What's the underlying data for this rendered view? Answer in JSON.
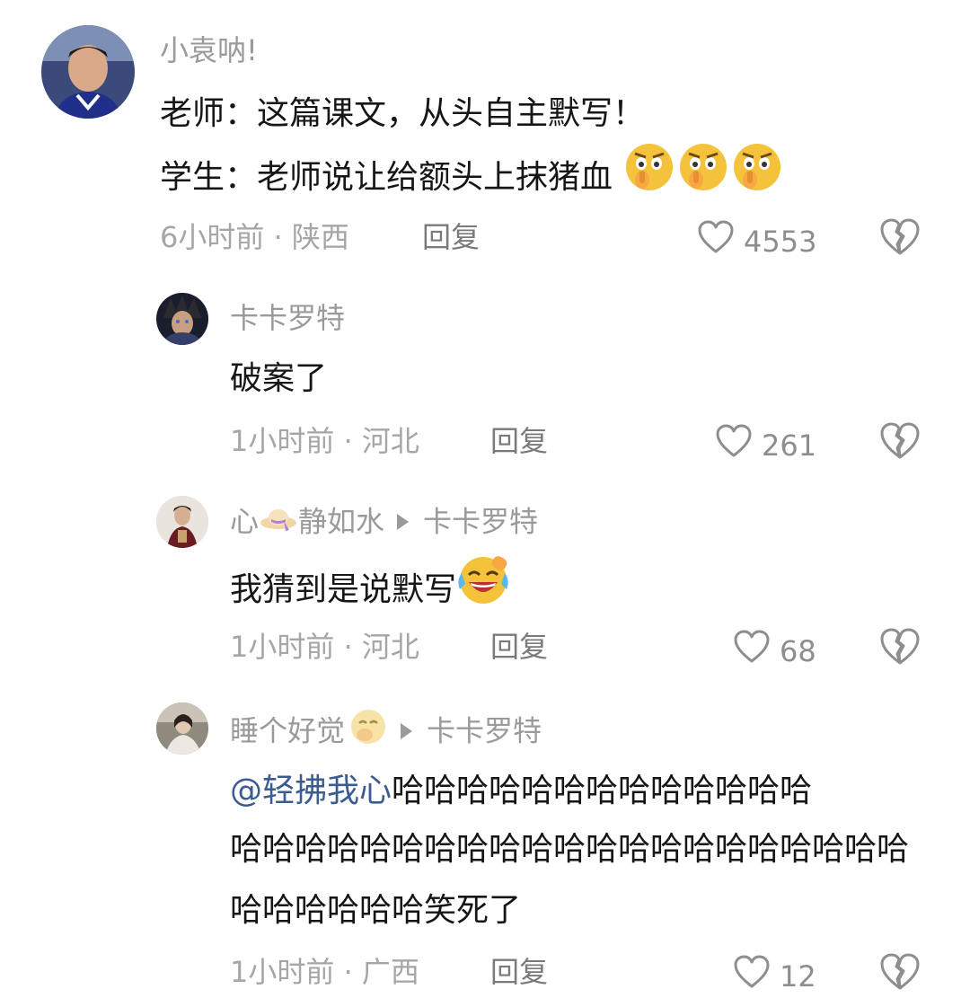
{
  "comments": [
    {
      "username": "小袁呐!",
      "lines": [
        "老师：这篇课文，从头自主默写！",
        "学生：老师说让给额头上抹猪血"
      ],
      "time": "6小时前",
      "location": "陕西",
      "reply_label": "回复",
      "likes": "4553",
      "trailing_emoji": "shush-face-icon"
    },
    {
      "username": "卡卡罗特",
      "text": "破案了",
      "time": "1小时前",
      "location": "河北",
      "reply_label": "回复",
      "likes": "261"
    },
    {
      "username_a": "心",
      "username_b": "静如水",
      "reply_to": "卡卡罗特",
      "text": "我猜到是说默写",
      "time": "1小时前",
      "location": "河北",
      "reply_label": "回复",
      "likes": "68",
      "trailing_emoji": "crying-laughing-icon"
    },
    {
      "username": "睡个好觉",
      "reply_to": "卡卡罗特",
      "mention": "@轻拂我心",
      "lines": [
        "哈哈哈哈哈哈哈哈哈哈哈哈哈",
        "哈哈哈哈哈哈哈哈哈哈哈哈哈哈哈哈哈哈哈哈哈",
        "哈哈哈哈哈哈笑死了"
      ],
      "time": "1小时前",
      "location": "广西",
      "reply_label": "回复",
      "likes": "12"
    }
  ],
  "separator": "·",
  "colors": {
    "meta": "#a6a6a6",
    "mention": "#3a5c90",
    "text": "#161616"
  }
}
